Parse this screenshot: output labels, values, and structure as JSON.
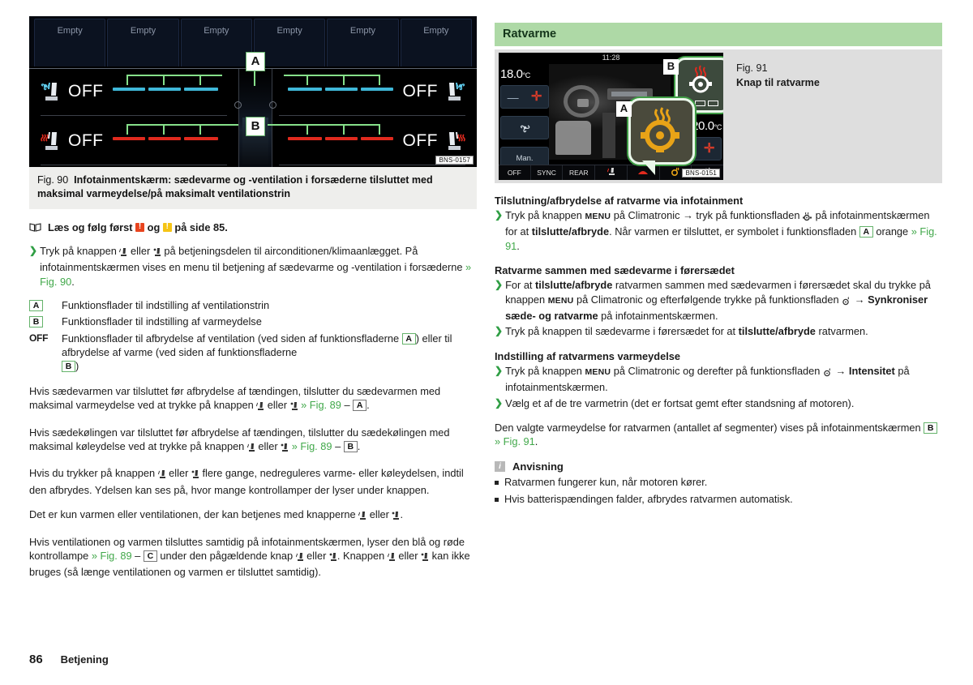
{
  "document": {
    "page_number": "86",
    "page_section": "Betjening"
  },
  "left_column": {
    "figure": {
      "id": "Fig. 90",
      "caption": "Infotainmentskærm: sædevarme og -ventilation i forsæderne tilsluttet med maksimal varmeydelse/på maksimalt ventilationstrin",
      "code": "BNS-0157",
      "callouts": [
        "A",
        "B"
      ],
      "tiles": [
        "Empty",
        "Empty",
        "Empty",
        "Empty",
        "Empty",
        "Empty"
      ],
      "off_labels": [
        "OFF",
        "OFF",
        "OFF",
        "OFF"
      ]
    },
    "read_first": {
      "prefix": "Læs og følg først",
      "mid": "og",
      "suffix": "på side 85."
    },
    "intro_bullet": "Tryk på knappen ⒨ eller ⒲ på betjeningsdelen til airconditionen/klimaanlægget. På infotainmentskærmen vises en menu til betjening af sædevarme og -ventilation i forsæderne » Fig. 90.",
    "legend": [
      {
        "key": "A",
        "key_type": "box",
        "text": "Funktionsflader til indstilling af ventilationstrin"
      },
      {
        "key": "B",
        "key_type": "box",
        "text": "Funktionsflader til indstilling af varmeydelse"
      },
      {
        "key": "OFF",
        "key_type": "text",
        "text": "Funktionsflader til afbrydelse af ventilation (ved siden af funktionsfladerne A ) eller til afbrydelse af varme (ved siden af funktionsfladerne B )"
      }
    ],
    "paragraphs": [
      "Hvis sædevarmen var tilsluttet før afbrydelse af tændingen, tilslutter du sædevarmen med maksimal varmeydelse ved at trykke på knappen ⒨ eller ⒲ » Fig. 89 – A .",
      "Hvis sædekølingen var tilsluttet før afbrydelse af tændingen, tilslutter du sædekølingen med maksimal køleydelse ved at trykke på knappen ⒨ eller ⒲ » Fig. 89 – B .",
      "Hvis du trykker på knappen ⒨ eller ⒲ flere gange, nedreguleres varme- eller køleydelsen, indtil den afbrydes. Ydelsen kan ses på, hvor mange kontrollamper der lyser under knappen.",
      "Det er kun varmen eller ventilationen, der kan betjenes med knapperne ⒨ eller ⒲ .",
      "Hvis ventilationen og varmen tilsluttes samtidig på infotainmentskærmen, lyser den blå og røde kontrollampe » Fig. 89 – C under den pågældende knap ⒨ eller ⒲ . Knappen ⒨ eller ⒲ kan ikke bruges (så længe ventilationen og varmen er tilsluttet samtidig)."
    ]
  },
  "right_column": {
    "section_title": "Ratvarme",
    "figure": {
      "id": "Fig. 91",
      "caption": "Knap til ratvarme",
      "code": "BNS-0151",
      "clock": "11:28",
      "temp_left": "18.0",
      "temp_right": "20.0",
      "temp_unit": "°C",
      "manual_button": "Man.",
      "callouts": [
        "A",
        "B"
      ],
      "bottom_bar": [
        "OFF",
        "SYNC",
        "REAR",
        "",
        "",
        "",
        ""
      ]
    },
    "sections": [
      {
        "heading": "Tilslutning/afbrydelse af ratvarme via infotainment",
        "bullets": [
          "Tryk på knappen MENU på Climatronic → tryk på funktionsfladen Ⓢ på infotainmentskærmen for at tilslutte/afbryde. Når varmen er tilsluttet, er symbolet i funktionsfladen A orange » Fig. 91."
        ]
      },
      {
        "heading": "Ratvarme sammen med sædevarme i førersædet",
        "bullets": [
          "For at tilslutte/afbryde ratvarmen sammen med sædevarmen i førersædet skal du trykke på knappen MENU på Climatronic og efterfølgende trykke på funktionsfladen ⚙ → Synkroniser sæde- og ratvarme på infotainmentskærmen.",
          "Tryk på knappen til sædevarme i førersædet for at tilslutte/afbryde ratvarmen."
        ]
      },
      {
        "heading": "Indstilling af ratvarmens varmeydelse",
        "bullets": [
          "Tryk på knappen MENU på Climatronic og derefter på funktionsfladen ⚙ → Intensitet på infotainmentskærmen.",
          "Vælg et af de tre varmetrin (det er fortsat gemt efter standsning af motoren)."
        ]
      }
    ],
    "closing_paragraph": "Den valgte varmeydelse for ratvarmen (antallet af segmenter) vises på infotainmentskærmen B » Fig. 91.",
    "note": {
      "title": "Anvisning",
      "items": [
        "Ratvarmen fungerer kun, når motoren kører.",
        "Hvis batterispændingen falder, afbrydes ratvarmen automatisk."
      ]
    }
  },
  "colors": {
    "section_header_bg": "#aed9a6",
    "figure_bg": "#eeeeec",
    "green_link": "#41a84a",
    "callout_border": "#65b36b",
    "warning_red": "#e8441e",
    "warning_yellow": "#f5c415",
    "screen_blue_segment": "#3fb8d8",
    "screen_red_segment": "#e02a1e",
    "screen_green_bracket": "#86e08a",
    "orange_symbol": "#e8a317"
  }
}
